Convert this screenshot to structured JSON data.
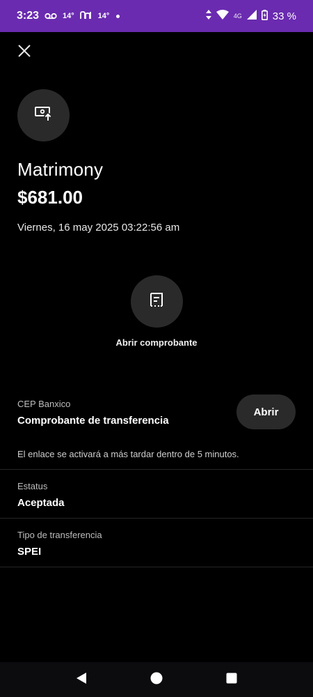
{
  "status_bar": {
    "time": "3:23",
    "temp1": "14°",
    "temp2": "14°",
    "network": "4G",
    "battery": "33 %"
  },
  "colors": {
    "status_bar_bg": "#6a2bb0",
    "background": "#000000",
    "surface": "#2a2a2a"
  },
  "header": {
    "close_icon": "close-icon"
  },
  "transfer": {
    "avatar_icon": "money-transfer-icon",
    "recipient": "Matrimony",
    "amount": "$681.00",
    "datetime": "Viernes, 16 may 2025 03:22:56 am"
  },
  "receipt_action": {
    "icon": "receipt-icon",
    "label": "Abrir comprobante"
  },
  "cep": {
    "caption": "CEP Banxico",
    "title": "Comprobante de transferencia",
    "open_button": "Abrir",
    "note": "El enlace se activará a más tardar dentro de 5 minutos."
  },
  "details": [
    {
      "label": "Estatus",
      "value": "Aceptada"
    },
    {
      "label": "Tipo de transferencia",
      "value": "SPEI"
    }
  ],
  "nav_bar": {
    "back_icon": "back-triangle-icon",
    "home_icon": "home-circle-icon",
    "recents_icon": "recents-square-icon"
  }
}
